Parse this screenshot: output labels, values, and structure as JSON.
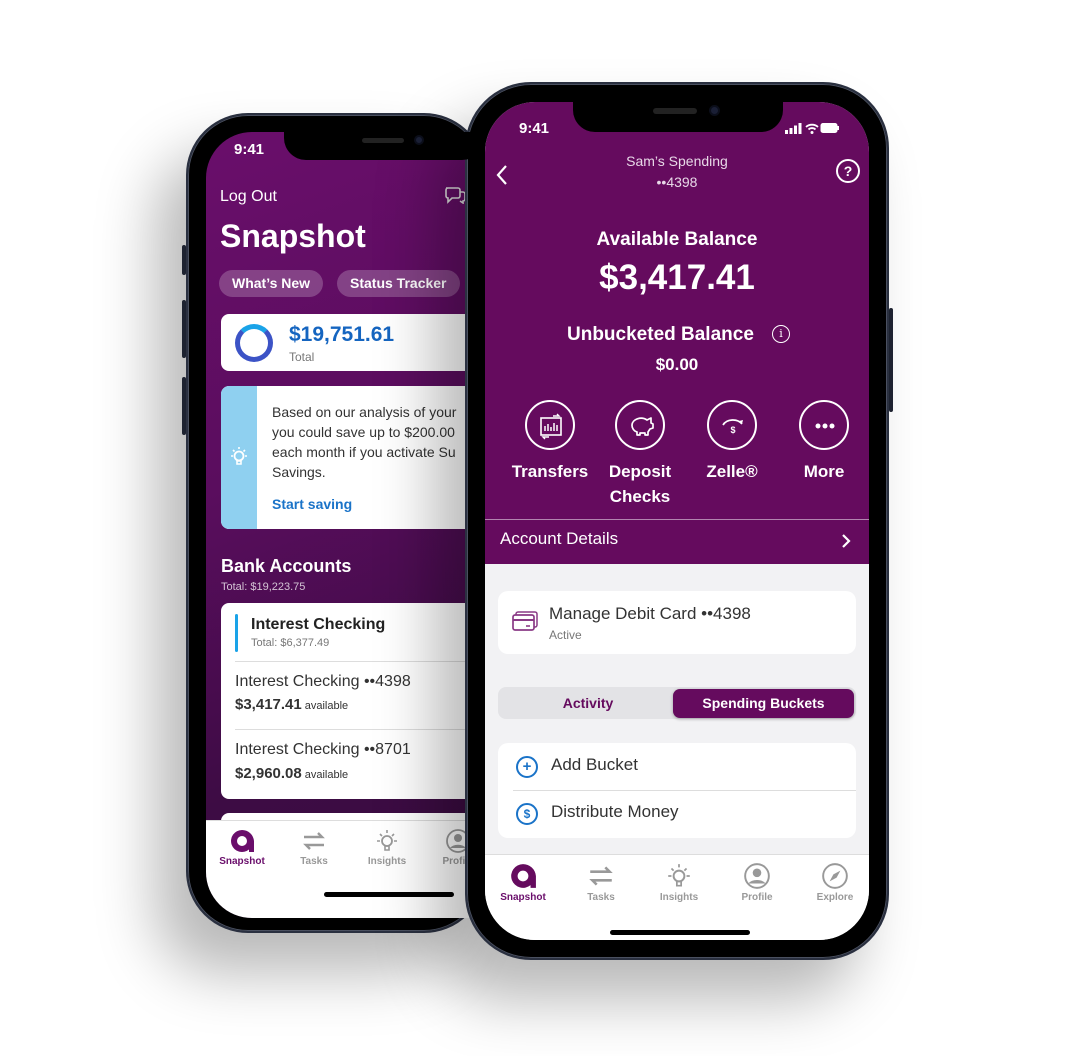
{
  "colors": {
    "brand_purple": "#650b5e",
    "link_blue": "#1a73c8",
    "total_blue": "#1565c0",
    "insight_bar": "#8fd0f0",
    "tab_inactive": "#999999"
  },
  "left_phone": {
    "status_time": "9:41",
    "logout_label": "Log Out",
    "chat_icon": "chat-bubbles-icon",
    "page_title": "Snapshot",
    "pills": [
      "What’s New",
      "Status Tracker"
    ],
    "total_card": {
      "amount": "$19,751.61",
      "label": "Total"
    },
    "insight": {
      "icon": "lightbulb-icon",
      "text": "Based on our analysis of your\nyou could save up to $200.00\neach month if you activate Su\nSavings.",
      "link": "Start saving"
    },
    "bank_accounts": {
      "heading": "Bank Accounts",
      "total": "Total: $19,223.75",
      "group": {
        "name": "Interest Checking",
        "total": "Total: $6,377.49"
      },
      "accounts": [
        {
          "name": "Interest Checking ••4398",
          "amount": "$3,417.41",
          "suffix": "available"
        },
        {
          "name": "Interest Checking ••8701",
          "amount": "$2,960.08",
          "suffix": "available"
        }
      ]
    },
    "tabs": [
      {
        "label": "Snapshot",
        "icon": "ally-logo-icon",
        "active": true
      },
      {
        "label": "Tasks",
        "icon": "transfer-arrows-icon",
        "active": false
      },
      {
        "label": "Insights",
        "icon": "lightbulb-icon",
        "active": false
      },
      {
        "label": "Profile",
        "icon": "profile-icon",
        "active": false
      }
    ]
  },
  "right_phone": {
    "status_time": "9:41",
    "header": {
      "title": "Sam’s Spending",
      "account_mask": "••4398",
      "help_label": "?"
    },
    "available_balance": {
      "label": "Available Balance",
      "amount": "$3,417.41"
    },
    "unbucketed_balance": {
      "label": "Unbucketed Balance",
      "amount": "$0.00",
      "info_label": "i"
    },
    "actions": [
      {
        "label": "Transfers",
        "icon": "transfers-icon"
      },
      {
        "label": "Deposit\nChecks",
        "icon": "piggy-bank-icon"
      },
      {
        "label": "Zelle®",
        "icon": "zelle-send-icon"
      },
      {
        "label": "More",
        "icon": "more-dots-icon"
      }
    ],
    "account_details_label": "Account Details",
    "debit_card": {
      "title": "Manage Debit Card ••4398",
      "status": "Active"
    },
    "segments": [
      {
        "label": "Activity",
        "active": false
      },
      {
        "label": "Spending Buckets",
        "active": true
      }
    ],
    "bucket_actions": [
      {
        "label": "Add Bucket",
        "icon": "add-circle-icon",
        "glyph": "+"
      },
      {
        "label": "Distribute Money",
        "icon": "dollar-circle-icon",
        "glyph": "$"
      }
    ],
    "tabs": [
      {
        "label": "Snapshot",
        "icon": "ally-logo-icon",
        "active": true
      },
      {
        "label": "Tasks",
        "icon": "transfer-arrows-icon",
        "active": false
      },
      {
        "label": "Insights",
        "icon": "lightbulb-icon",
        "active": false
      },
      {
        "label": "Profile",
        "icon": "profile-icon",
        "active": false
      },
      {
        "label": "Explore",
        "icon": "compass-icon",
        "active": false
      }
    ]
  }
}
